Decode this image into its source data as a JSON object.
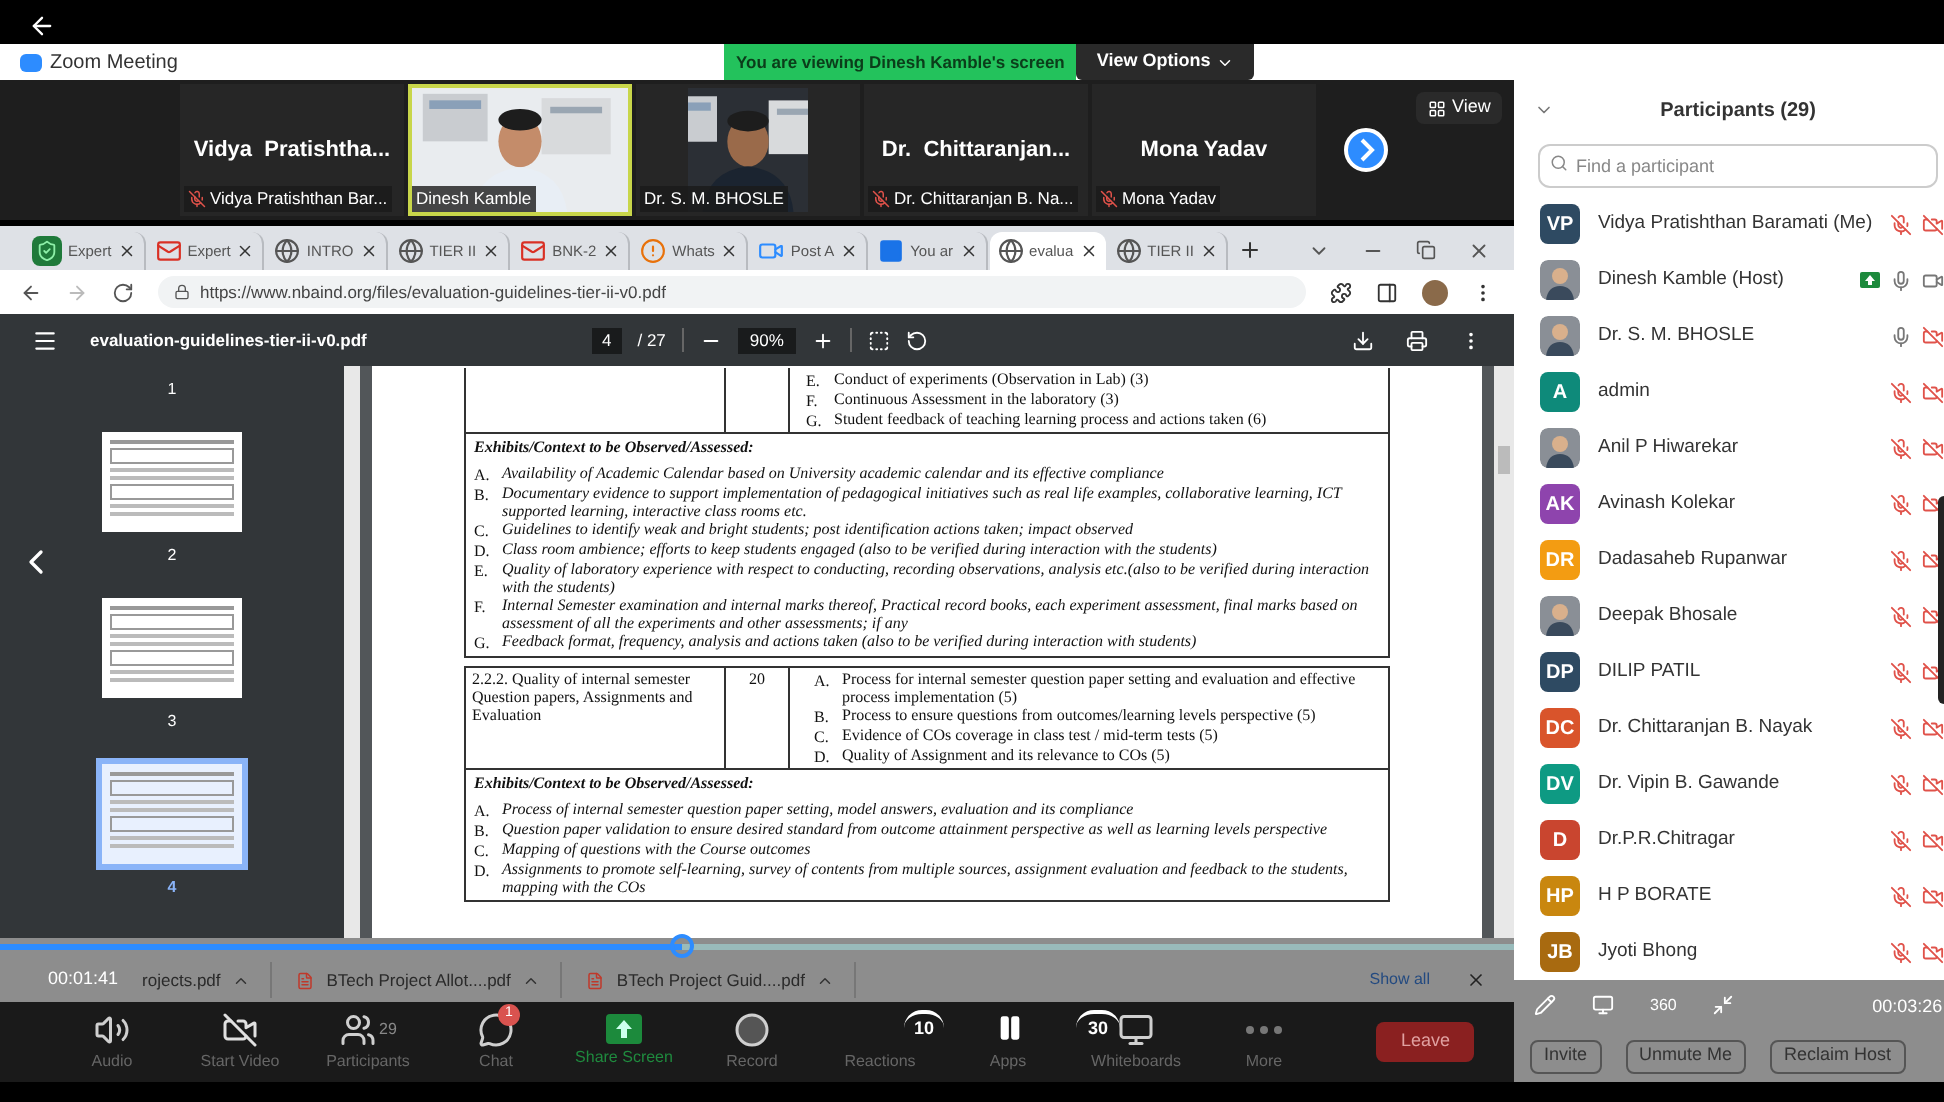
{
  "window": {
    "title": "Zoom Meeting"
  },
  "banner": "You are viewing Dinesh Kamble's screen",
  "view_options": "View Options",
  "video_strip": {
    "tiles": [
      {
        "kind": "name",
        "display": "Vidya  Pratishtha...",
        "label": "Vidya Pratishthan Bar...",
        "muted": true,
        "speaking": false
      },
      {
        "kind": "video",
        "label": "Dinesh Kamble",
        "muted": false,
        "speaking": true
      },
      {
        "kind": "video",
        "label": "Dr. S. M. BHOSLE",
        "muted": false,
        "speaking": false
      },
      {
        "kind": "name",
        "display": "Dr.  Chittaranjan...",
        "label": "Dr. Chittaranjan B. Na...",
        "muted": true,
        "speaking": false
      },
      {
        "kind": "name",
        "display": "Mona Yadav",
        "label": "Mona Yadav",
        "muted": true,
        "speaking": false
      }
    ],
    "view_button": "View"
  },
  "browser": {
    "tabs": [
      {
        "kind": "shield",
        "label": "Expert",
        "selected": false
      },
      {
        "kind": "mail",
        "label": "Expert",
        "selected": false
      },
      {
        "kind": "globe",
        "label": "INTRO",
        "selected": false
      },
      {
        "kind": "globe",
        "label": "TIER II",
        "selected": false
      },
      {
        "kind": "mail",
        "label": "BNK-2",
        "selected": false
      },
      {
        "kind": "alert",
        "label": "Whats",
        "selected": false
      },
      {
        "kind": "video",
        "label": "Post A",
        "selected": false
      },
      {
        "kind": "doc",
        "label": "You ar",
        "selected": false
      },
      {
        "kind": "globe",
        "label": "evalua",
        "selected": true
      },
      {
        "kind": "globe",
        "label": "TIER II",
        "selected": false
      }
    ],
    "address": "https://www.nbaind.org/files/evaluation-guidelines-tier-ii-v0.pdf"
  },
  "pdf": {
    "filename": "evaluation-guidelines-tier-ii-v0.pdf",
    "page": "4",
    "pages": "/ 27",
    "zoom": "90%",
    "thumbnails": [
      {
        "kind": "label_only",
        "label": "1",
        "selected": false
      },
      {
        "kind": "page",
        "label": "2",
        "selected": false
      },
      {
        "kind": "page",
        "label": "3",
        "selected": false
      },
      {
        "kind": "page",
        "label": "4",
        "selected": true
      }
    ],
    "top_items": [
      {
        "letter": "E.",
        "text": "Conduct of experiments (Observation in Lab) (3)"
      },
      {
        "letter": "F.",
        "text": "Continuous Assessment in the laboratory (3)"
      },
      {
        "letter": "G.",
        "text": "Student feedback of teaching learning process and actions taken (6)"
      }
    ],
    "exhibits_1": {
      "heading": "Exhibits/Context to be Observed/Assessed:",
      "items": [
        {
          "letter": "A.",
          "text": "Availability of Academic Calendar based on University academic calendar and its effective compliance"
        },
        {
          "letter": "B.",
          "text": "Documentary evidence to support implementation of pedagogical initiatives such as real life examples, collaborative learning, ICT supported learning, interactive class rooms etc."
        },
        {
          "letter": "C.",
          "text": "Guidelines to identify weak and bright students; post identification actions taken; impact observed"
        },
        {
          "letter": "D.",
          "text": "Class room ambience; efforts to keep students engaged (also to be verified during interaction with the students)"
        },
        {
          "letter": "E.",
          "text": "Quality of laboratory experience with respect to conducting, recording observations, analysis etc.(also to be verified during interaction with the students)"
        },
        {
          "letter": "F.",
          "text": "Internal Semester examination and internal marks thereof, Practical record books, each experiment assessment, final marks based on assessment of all the experiments and other assessments; if any"
        },
        {
          "letter": "G.",
          "text": "Feedback format, frequency, analysis and actions taken (also to be verified during interaction with students)"
        }
      ]
    },
    "criterion": {
      "title": "2.2.2. Quality of internal semester Question papers, Assignments and Evaluation",
      "marks": "20",
      "items": [
        {
          "letter": "A.",
          "text": "Process for internal semester question paper setting and evaluation and effective process implementation (5)"
        },
        {
          "letter": "B.",
          "text": "Process to ensure questions from outcomes/learning levels perspective (5)"
        },
        {
          "letter": "C.",
          "text": "Evidence of COs coverage in class test / mid-term tests (5)"
        },
        {
          "letter": "D.",
          "text": "Quality of Assignment and its relevance to COs (5)"
        }
      ]
    },
    "exhibits_2": {
      "heading": "Exhibits/Context to be Observed/Assessed:",
      "items": [
        {
          "letter": "A.",
          "text": "Process of internal semester question paper setting, model answers, evaluation and its compliance"
        },
        {
          "letter": "B.",
          "text": "Question paper validation to ensure desired standard from outcome attainment perspective as well as learning levels perspective"
        },
        {
          "letter": "C.",
          "text": "Mapping of questions with the Course outcomes"
        },
        {
          "letter": "D.",
          "text": "Assignments to promote self-learning, survey of contents from multiple sources, assignment evaluation and feedback to the students, mapping with the COs"
        }
      ]
    }
  },
  "player": {
    "elapsed": "00:01:41",
    "remaining": "00:03:26",
    "level": 0.45,
    "rewind": "10",
    "forward": "30",
    "vr": "360"
  },
  "downloads": {
    "items": [
      "rojects.pdf",
      "BTech Project Allot....pdf",
      "BTech Project Guid....pdf"
    ],
    "show_all": "Show all"
  },
  "toolbar": {
    "items": [
      {
        "kind": "audio",
        "label": "Audio"
      },
      {
        "kind": "video",
        "label": "Start Video"
      },
      {
        "kind": "participants",
        "label": "Participants",
        "count": "29"
      },
      {
        "kind": "chat",
        "label": "Chat",
        "badge": "1"
      },
      {
        "kind": "share",
        "label": "Share Screen"
      },
      {
        "kind": "record",
        "label": "Record"
      },
      {
        "kind": "reactions",
        "label": "Reactions"
      },
      {
        "kind": "apps",
        "label": "Apps"
      },
      {
        "kind": "whiteboard",
        "label": "Whiteboards"
      },
      {
        "kind": "more",
        "label": "More"
      }
    ],
    "leave": "Leave"
  },
  "participants": {
    "title": "Participants (29)",
    "search": {
      "placeholder": "Find a participant"
    },
    "items": [
      {
        "name": "Vidya Pratishthan Baramati (Me)",
        "avatar": {
          "kind": "initials",
          "initials": "VP",
          "color": "#2e4a62"
        },
        "sharing": false,
        "muted": true,
        "video_on": false
      },
      {
        "name": "Dinesh Kamble (Host)",
        "sharing": true,
        "muted": false,
        "video_on": true
      },
      {
        "name": "Dr. S. M. BHOSLE",
        "sharing": false,
        "muted": false,
        "video_on": false
      },
      {
        "name": "admin",
        "avatar": {
          "kind": "initials",
          "initials": "A",
          "color": "#0e8a7a"
        },
        "sharing": false,
        "muted": true,
        "video_on": false
      },
      {
        "name": "Anil P Hiwarekar",
        "sharing": false,
        "muted": true,
        "video_on": false
      },
      {
        "name": "Avinash Kolekar",
        "avatar": {
          "kind": "initials",
          "initials": "AK",
          "color": "#8e44ad"
        },
        "sharing": false,
        "muted": true,
        "video_on": false
      },
      {
        "name": "Dadasaheb Rupanwar",
        "avatar": {
          "kind": "initials",
          "initials": "DR",
          "color": "#f39c12"
        },
        "sharing": false,
        "muted": true,
        "video_on": false
      },
      {
        "name": "Deepak Bhosale",
        "sharing": false,
        "muted": true,
        "video_on": false
      },
      {
        "name": "DILIP PATIL",
        "avatar": {
          "kind": "initials",
          "initials": "DP",
          "color": "#2e4a62"
        },
        "sharing": false,
        "muted": true,
        "video_on": false
      },
      {
        "name": "Dr. Chittaranjan B. Nayak",
        "avatar": {
          "kind": "initials",
          "initials": "DC",
          "color": "#d9542b"
        },
        "sharing": false,
        "muted": true,
        "video_on": false
      },
      {
        "name": "Dr. Vipin B. Gawande",
        "avatar": {
          "kind": "initials",
          "initials": "DV",
          "color": "#0e9a83"
        },
        "sharing": false,
        "muted": true,
        "video_on": false
      },
      {
        "name": "Dr.P.R.Chitragar",
        "avatar": {
          "kind": "initials",
          "initials": "D",
          "color": "#c9452f"
        },
        "sharing": false,
        "muted": true,
        "video_on": false
      },
      {
        "name": "H P BORATE",
        "avatar": {
          "kind": "initials",
          "initials": "HP",
          "color": "#c9870f"
        },
        "sharing": false,
        "muted": true,
        "video_on": false
      },
      {
        "name": "Jyoti Bhong",
        "avatar": {
          "kind": "initials",
          "initials": "JB",
          "color": "#a86a10"
        },
        "sharing": false,
        "muted": true,
        "video_on": false
      }
    ],
    "buttons": [
      "Invite",
      "Unmute Me",
      "Reclaim Host"
    ]
  }
}
